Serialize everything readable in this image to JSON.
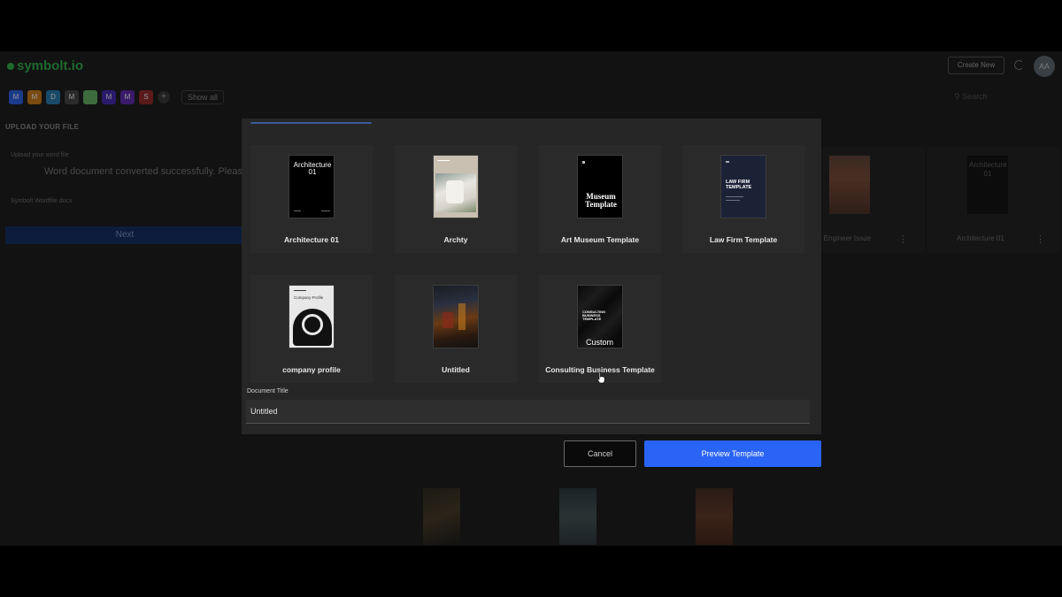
{
  "app": {
    "logo": "symbolt.io",
    "create_new": "Create New",
    "avatar_initials": "AA",
    "show_all": "Show all",
    "search_placeholder": "Search",
    "chips": [
      {
        "letter": "M",
        "color": "#1b3a8a"
      },
      {
        "letter": "M",
        "color": "#7a4a10"
      },
      {
        "letter": "D",
        "color": "#1a4a6a"
      },
      {
        "letter": "M",
        "color": "#2a2a2a"
      },
      {
        "letter": "",
        "color": "#3d6b3d"
      },
      {
        "letter": "M",
        "color": "#2a1a6a"
      },
      {
        "letter": "M",
        "color": "#3a1a6a"
      },
      {
        "letter": "S",
        "color": "#5a1a1a"
      }
    ],
    "add_chip": "+"
  },
  "upload": {
    "title": "UPLOAD YOUR FILE",
    "field_label": "Upload your word file",
    "message": "Word document converted successfully. Please wait",
    "file_name": "Symbolt Wordfile.docx",
    "next": "Next"
  },
  "background_cards": [
    {
      "label": "e Engineer Issue"
    },
    {
      "label": "Architecture 01",
      "thumb_title": "Architecture 01"
    }
  ],
  "templates": [
    {
      "name": "Architecture 01",
      "thumb_title": "Architecture 01"
    },
    {
      "name": "Archty"
    },
    {
      "name": "Art Museum Template",
      "thumb_title": "Museum Template"
    },
    {
      "name": "Law Firm Template",
      "thumb_title": "LAW FIRM TEMPLATE"
    },
    {
      "name": "company profile",
      "thumb_title": "Company Profile"
    },
    {
      "name": "Untitled"
    },
    {
      "name": "Consulting Business Template",
      "thumb_title": "CONSULTING BUSINESS TEMPLATE",
      "thumb_badge": "Custom"
    }
  ],
  "document_title": {
    "label": "Document Title",
    "value": "Untitled"
  },
  "actions": {
    "cancel": "Cancel",
    "preview": "Preview Template"
  },
  "colors": {
    "accent": "#2a64f6",
    "modal_bg": "#262626",
    "tile_bg": "#2a2a2a"
  }
}
